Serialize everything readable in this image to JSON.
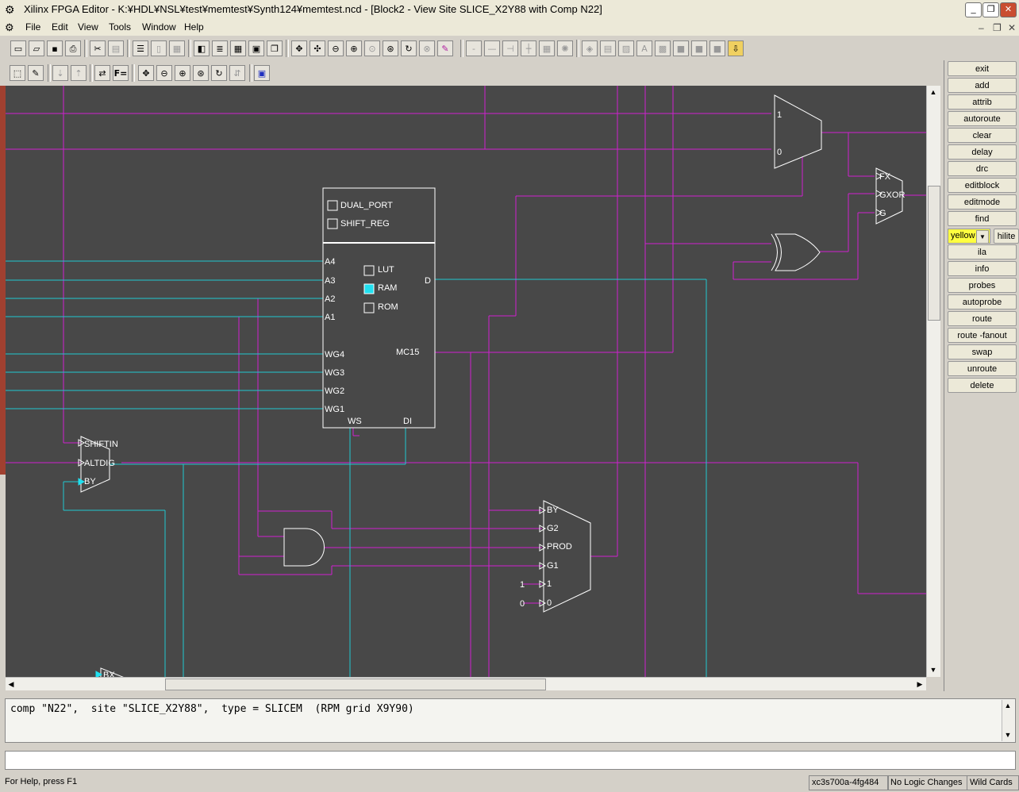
{
  "window": {
    "title": "Xilinx FPGA Editor - K:¥HDL¥NSL¥test¥memtest¥Synth124¥memtest.ncd - [Block2 - View Site SLICE_X2Y88 with Comp N22]"
  },
  "menu": {
    "items": [
      "File",
      "Edit",
      "View",
      "Tools",
      "Window",
      "Help"
    ]
  },
  "right_panel": {
    "buttons": [
      "exit",
      "add",
      "attrib",
      "autoroute",
      "clear",
      "delay",
      "drc",
      "editblock",
      "editmode",
      "find",
      "ila",
      "info",
      "probes",
      "autoprobe",
      "route",
      "route -fanout",
      "swap",
      "unroute",
      "delete"
    ],
    "color_select": "yellow",
    "hilite_label": "hilite"
  },
  "schematic": {
    "lut_box": {
      "options": [
        "DUAL_PORT",
        "SHIFT_REG"
      ],
      "mode_options": [
        "LUT",
        "RAM",
        "ROM"
      ],
      "selected_mode": "RAM",
      "inputs": [
        "A4",
        "A3",
        "A2",
        "A1",
        "WG4",
        "WG3",
        "WG2",
        "WG1"
      ],
      "outputs": [
        "D",
        "MC15"
      ],
      "bottom_pins": [
        "WS",
        "DI"
      ]
    },
    "mux_top": {
      "pins": [
        "1",
        "0"
      ]
    },
    "gxor": {
      "pins": [
        "FX",
        "GXOR",
        "G"
      ]
    },
    "shift_block": {
      "pins": [
        "SHIFTIN",
        "ALTDIG",
        "BY"
      ]
    },
    "gmux": {
      "pins": [
        "BY",
        "G2",
        "PROD",
        "G1",
        "1",
        "0"
      ],
      "consts": [
        "1",
        "0"
      ]
    },
    "bottom_pin": "BX",
    "colors": {
      "background": "#484848",
      "net_magenta": "#d020d0",
      "net_cyan": "#20c8d0",
      "component": "#ffffff"
    }
  },
  "console": {
    "text": "comp \"N22\",  site \"SLICE_X2Y88\",  type = SLICEM  (RPM grid X9Y90)"
  },
  "status": {
    "help": "For Help, press F1",
    "device": "xc3s700a-4fg484",
    "logic": "No Logic Changes",
    "wild": "Wild Cards"
  }
}
